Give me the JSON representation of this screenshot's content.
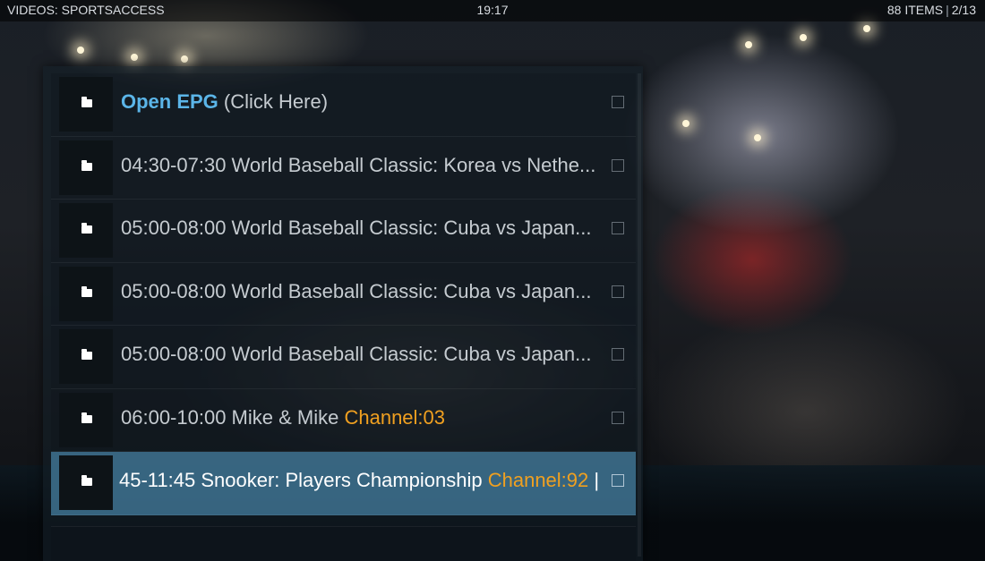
{
  "header": {
    "section": "VIDEOS: SPORTSACCESS",
    "clock": "19:17",
    "items_count": "88 ITEMS",
    "separator": "|",
    "page": "2/13"
  },
  "list": {
    "rows": [
      {
        "main": "Open EPG",
        "suffix": " (Click Here)",
        "channel": ""
      },
      {
        "main": "04:30-07:30 World Baseball Classic: Korea vs Nethe...",
        "suffix": "",
        "channel": ""
      },
      {
        "main": "05:00-08:00 World Baseball Classic: Cuba vs Japan...",
        "suffix": "",
        "channel": ""
      },
      {
        "main": "05:00-08:00 World Baseball Classic: Cuba vs Japan...",
        "suffix": "",
        "channel": ""
      },
      {
        "main": "05:00-08:00 World Baseball Classic: Cuba vs Japan...",
        "suffix": "",
        "channel": ""
      },
      {
        "main": "06:00-10:00 Mike & Mike ",
        "suffix": "",
        "channel": "Channel:03"
      },
      {
        "main": "45-11:45 Snooker: Players Championship ",
        "suffix": "",
        "channel": "Channel:92",
        "tail": " |"
      }
    ]
  },
  "icons": {
    "row_icon": "folder-icon",
    "row_toggle": "checkbox-icon"
  },
  "colors": {
    "accent_blue": "#5bb5e8",
    "accent_orange": "#f0a020",
    "selection": "#4682a5"
  }
}
